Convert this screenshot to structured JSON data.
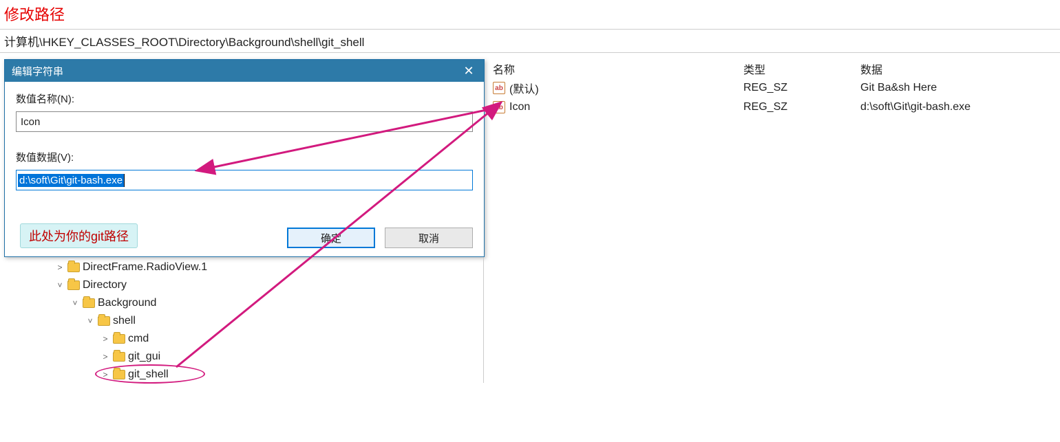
{
  "annotation": {
    "title": "修改路径",
    "tip": "此处为你的git路径"
  },
  "address_bar": "计算机\\HKEY_CLASSES_ROOT\\Directory\\Background\\shell\\git_shell",
  "dialog": {
    "title": "编辑字符串",
    "close_glyph": "✕",
    "name_label": "数值名称(N):",
    "name_value": "Icon",
    "data_label": "数值数据(V):",
    "data_value": "d:\\soft\\Git\\git-bash.exe",
    "ok": "确定",
    "cancel": "取消"
  },
  "values": {
    "headers": {
      "name": "名称",
      "type": "类型",
      "data": "数据"
    },
    "rows": [
      {
        "icon": "ab",
        "name": "(默认)",
        "type": "REG_SZ",
        "data": "Git Ba&sh Here"
      },
      {
        "icon": "ab",
        "name": "Icon",
        "type": "REG_SZ",
        "data": "d:\\soft\\Git\\git-bash.exe"
      }
    ]
  },
  "tree": {
    "items": [
      {
        "expander": ">",
        "indent": 2,
        "label": "DirectFrame.RadioView.1"
      },
      {
        "expander": "˅",
        "indent": 2,
        "label": "Directory"
      },
      {
        "expander": "˅",
        "indent": 3,
        "label": "Background"
      },
      {
        "expander": "˅",
        "indent": 4,
        "label": "shell"
      },
      {
        "expander": ">",
        "indent": 5,
        "label": "cmd"
      },
      {
        "expander": ">",
        "indent": 5,
        "label": "git_gui"
      },
      {
        "expander": ">",
        "indent": 5,
        "label": "git_shell"
      }
    ]
  }
}
